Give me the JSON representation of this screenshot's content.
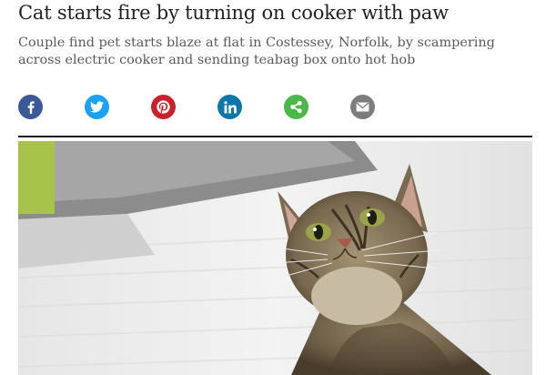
{
  "article": {
    "headline": "Cat starts fire by turning on cooker with paw",
    "standfirst": "Couple find pet starts blaze at flat in Costessey, Norfolk, by scampering across electric cooker and sending teabag box onto hot hob"
  },
  "share": {
    "buttons": [
      {
        "name": "facebook",
        "icon": "facebook-icon",
        "color": "#3b5998"
      },
      {
        "name": "twitter",
        "icon": "twitter-icon",
        "color": "#1da1f2"
      },
      {
        "name": "pinterest",
        "icon": "pinterest-icon",
        "color": "#c8232c"
      },
      {
        "name": "linkedin",
        "icon": "linkedin-icon",
        "color": "#0e76a8"
      },
      {
        "name": "share",
        "icon": "share-icon",
        "color": "#4cb849"
      },
      {
        "name": "email",
        "icon": "email-icon",
        "color": "#7d7d7d"
      }
    ]
  },
  "colors": {
    "headline": "#222222",
    "standfirst": "#5a5a5a",
    "rule": "#1a1a1a"
  }
}
